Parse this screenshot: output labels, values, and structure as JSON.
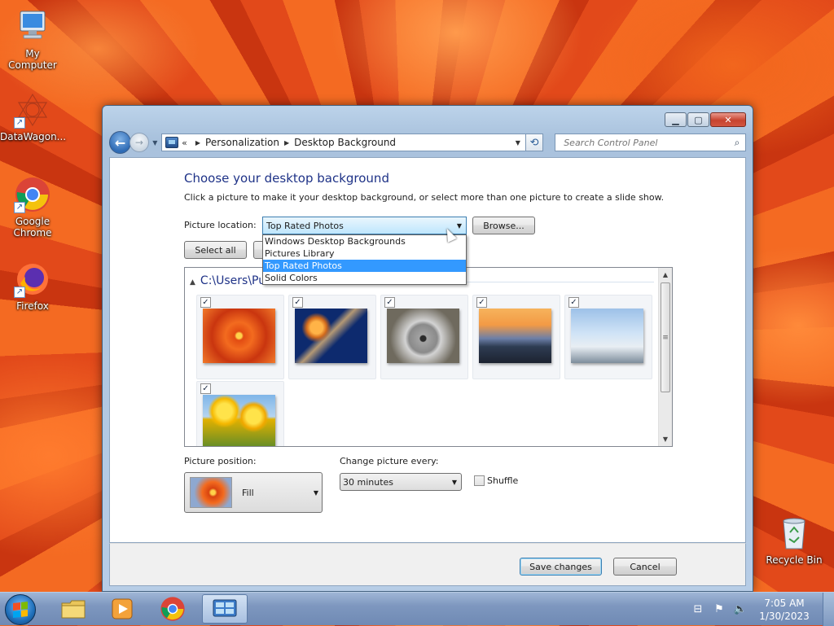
{
  "desktop": {
    "icons": [
      {
        "label": "My Computer"
      },
      {
        "label": "DataWagon..."
      },
      {
        "label": "Google Chrome"
      },
      {
        "label": "Firefox"
      },
      {
        "label": "Recycle Bin"
      }
    ]
  },
  "window": {
    "breadcrumb": {
      "lead": "«",
      "items": [
        "Personalization",
        "Desktop Background"
      ]
    },
    "search_placeholder": "Search Control Panel",
    "heading": "Choose your desktop background",
    "subtext": "Click a picture to make it your desktop background, or select more than one picture to create a slide show.",
    "picture_location": {
      "label": "Picture location:",
      "value": "Top Rated Photos",
      "options": [
        "Windows Desktop Backgrounds",
        "Pictures Library",
        "Top Rated Photos",
        "Solid Colors"
      ],
      "selected_index": 2
    },
    "browse_label": "Browse...",
    "select_all_label": "Select all",
    "group_header": "C:\\Users\\Pu",
    "pictures": [
      {
        "name": "flower-orange",
        "checked": true
      },
      {
        "name": "jellyfish",
        "checked": true
      },
      {
        "name": "koala",
        "checked": true
      },
      {
        "name": "lighthouse",
        "checked": true
      },
      {
        "name": "penguins",
        "checked": true
      },
      {
        "name": "tulips",
        "checked": true
      }
    ],
    "check_mark": "✓",
    "picture_position": {
      "label": "Picture position:",
      "value": "Fill"
    },
    "change_picture": {
      "label": "Change picture every:",
      "value": "30 minutes"
    },
    "shuffle": {
      "label": "Shuffle",
      "checked": false
    },
    "save_label": "Save changes",
    "cancel_label": "Cancel"
  },
  "taskbar": {
    "time": "7:05 AM",
    "date": "1/30/2023"
  }
}
